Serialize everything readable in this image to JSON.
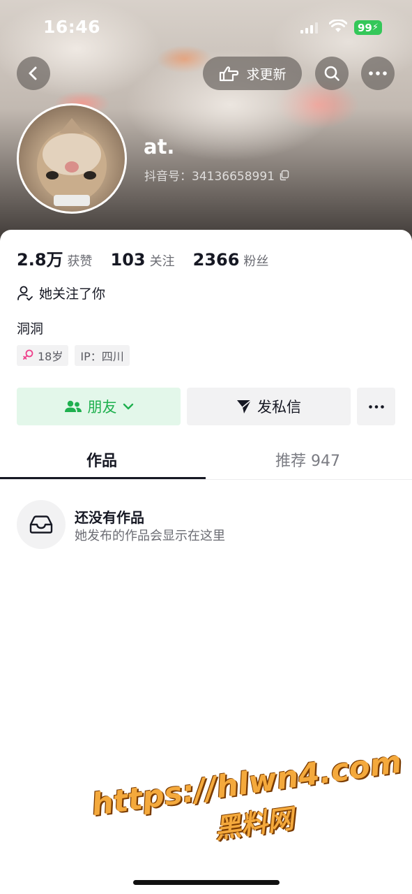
{
  "status_bar": {
    "time": "16:46",
    "battery": "99"
  },
  "header": {
    "update_button_label": "求更新"
  },
  "profile": {
    "nickname": "at.",
    "douyin_id": "抖音号：34136658991",
    "stats": [
      {
        "value": "2.8万",
        "label": "获赞"
      },
      {
        "value": "103",
        "label": "关注"
      },
      {
        "value": "2366",
        "label": "粉丝"
      }
    ],
    "follow_status": "她关注了你",
    "bio": "洞洞",
    "tags": {
      "age": "18岁",
      "ip": "IP：四川"
    }
  },
  "actions": {
    "friend_label": "朋友",
    "message_label": "发私信"
  },
  "tabs": {
    "works": "作品",
    "recommend": "推荐 947"
  },
  "empty_state": {
    "title": "还没有作品",
    "subtitle": "她发布的作品会显示在这里"
  },
  "watermark": {
    "url": "https://hlwn4.com",
    "name": "黑料网"
  },
  "colors": {
    "friend_green": "#1fb04f",
    "battery_green": "#34c759",
    "watermark_orange": "#f4a93c"
  }
}
